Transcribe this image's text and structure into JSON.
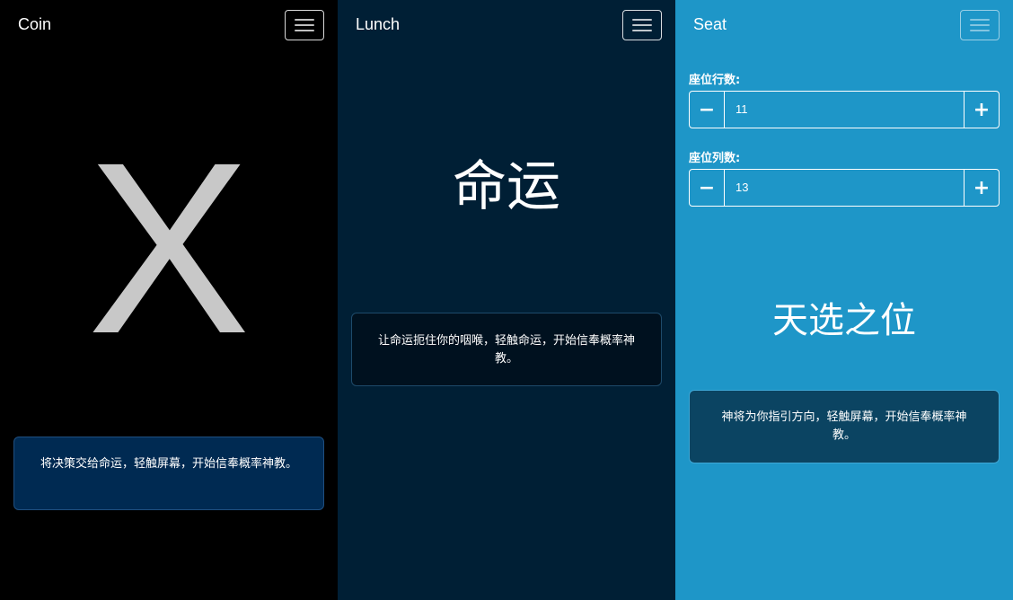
{
  "coin": {
    "brand": "Coin",
    "result": "X",
    "card_text": "将决策交给命运，轻触屏幕，开始信奉概率神教。"
  },
  "lunch": {
    "brand": "Lunch",
    "result": "命运",
    "card_text": "让命运扼住你的咽喉，轻触命运，开始信奉概率神教。"
  },
  "seat": {
    "brand": "Seat",
    "rows_label": "座位行数:",
    "rows_value": "11",
    "cols_label": "座位列数:",
    "cols_value": "13",
    "minus_label": "−",
    "plus_label": "+",
    "result": "天选之位",
    "card_text": "神将为你指引方向，轻触屏幕，开始信奉概率神教。"
  },
  "colors": {
    "coin_bg": "#000000",
    "lunch_bg": "#001f35",
    "seat_bg": "#1e96c8"
  },
  "icons": {
    "menu": "hamburger-menu-icon"
  }
}
